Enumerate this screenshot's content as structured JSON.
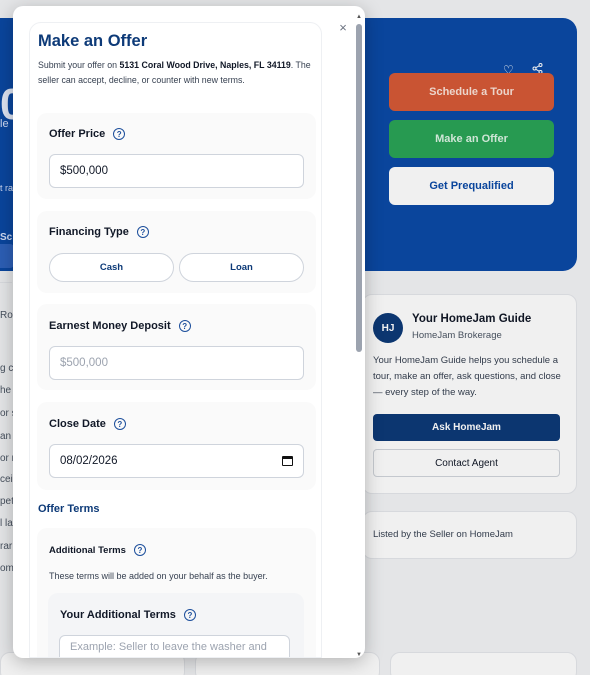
{
  "background": {
    "hero": {
      "big_text": "0",
      "fragments": [
        "le",
        "t ra",
        "Sc"
      ],
      "buttons": {
        "schedule_tour": "Schedule a Tour",
        "make_offer": "Make an Offer",
        "get_prequalified": "Get Prequalified"
      }
    },
    "left_fragments": [
      "Roo",
      "g c",
      "he",
      "or s",
      "an",
      "or r",
      "ceil",
      "pet",
      "l la",
      "rar",
      "om"
    ],
    "guide": {
      "avatar": "HJ",
      "title": "Your HomeJam Guide",
      "subtitle": "HomeJam Brokerage",
      "description": "Your HomeJam Guide helps you schedule a tour, make an offer, ask questions, and close — every step of the way.",
      "ask_button": "Ask HomeJam",
      "contact_button": "Contact Agent"
    },
    "listed_by": "Listed by the Seller on HomeJam"
  },
  "modal": {
    "title": "Make an Offer",
    "desc_prefix": "Submit your offer on ",
    "address": "5131 Coral Wood Drive, Naples, FL 34119",
    "desc_suffix": ". The seller can accept, decline, or counter with new terms.",
    "close_glyph": "×",
    "offer_price": {
      "label": "Offer Price",
      "value": "$500,000"
    },
    "financing": {
      "label": "Financing Type",
      "options": [
        "Cash",
        "Loan"
      ]
    },
    "earnest": {
      "label": "Earnest Money Deposit",
      "placeholder": "$500,000"
    },
    "close_date": {
      "label": "Close Date",
      "value": "08/02/2026"
    },
    "offer_terms_heading": "Offer Terms",
    "additional_terms": {
      "label": "Additional Terms",
      "description": "These terms will be added on your behalf as the buyer.",
      "your_terms_label": "Your Additional Terms",
      "placeholder": "Example: Seller to leave the washer and dryer."
    },
    "help_glyph": "?"
  }
}
